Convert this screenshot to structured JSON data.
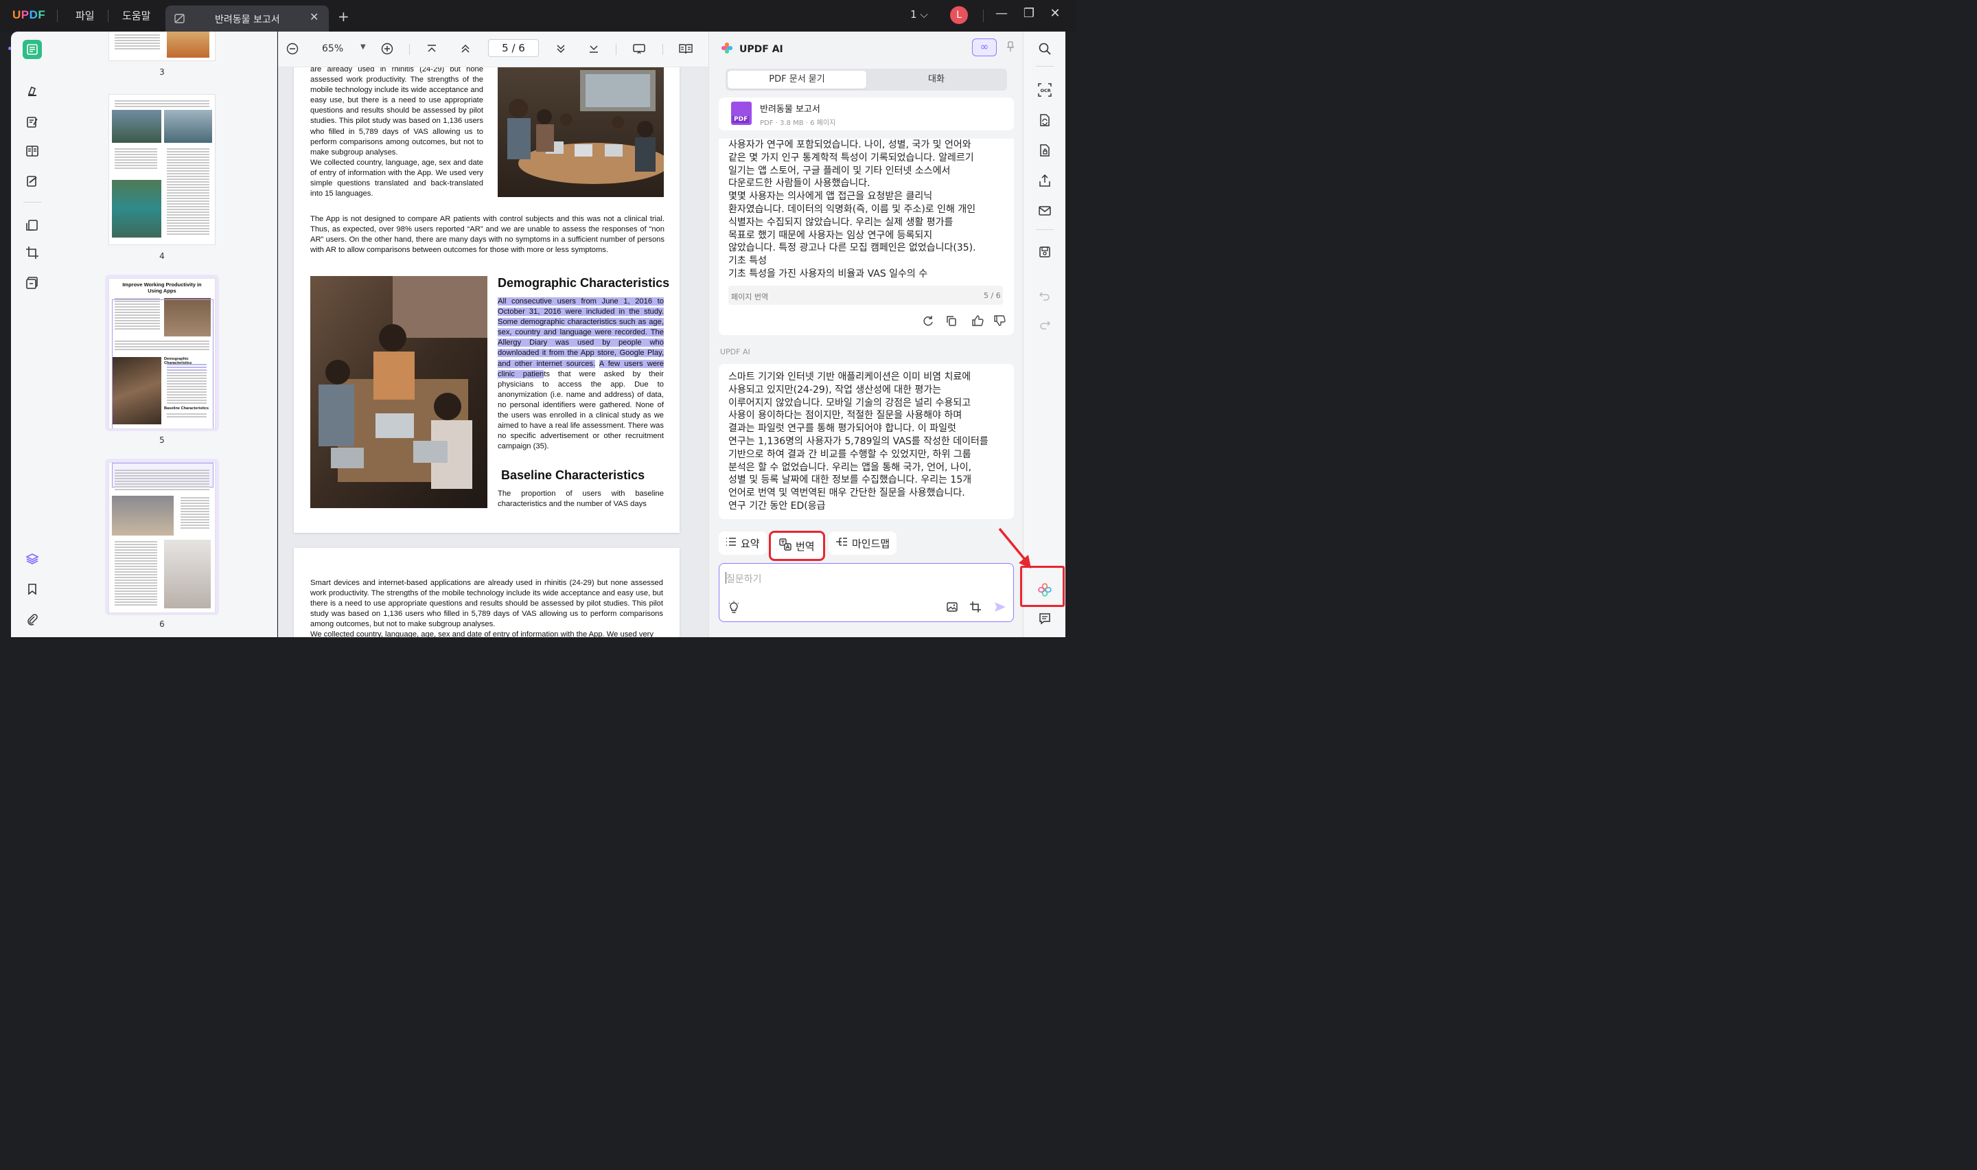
{
  "app": {
    "logo": "UPDF",
    "menus": [
      "파일",
      "도움말"
    ],
    "tab_title": "반려동물 보고서",
    "page_indicator": "1",
    "avatar_letter": "L"
  },
  "thumbnails": {
    "pages": [
      {
        "num": "3"
      },
      {
        "num": "4"
      },
      {
        "num": "5",
        "title": "Improve Working Productivity in Using Apps",
        "heading1": "Demographic Characteristics",
        "heading2": "Baseline Characteristics"
      },
      {
        "num": "6"
      }
    ]
  },
  "toolbar": {
    "zoom": "65%",
    "page_current": "5",
    "page_total": "6"
  },
  "document": {
    "col_top": "are already used in rhinitis (24-29) but none assessed work productivity. The strengths of the mobile technology include its wide acceptance and easy use, but there is a need to use appropriate questions and results should be assessed by pilot studies. This pilot study was based on 1,136 users who filled in 5,789 days of VAS allowing us to perform comparisons among outcomes, but not to make subgroup analyses.",
    "col_top2": "We collected country, language, age, sex and date of entry of information with the App. We used very simple questions translated and back-translated into 15 languages.",
    "para_full": "The App is not designed to compare AR patients with control subjects and this was not a clinical trial. Thus, as expected, over 98% users reported “AR” and we are unable to assess the responses of “non AR” users. On the other hand, there are many days with no symptoms in a sufficient number of persons with AR to allow comparisons between outcomes for those with more or less symptoms.",
    "heading_demo": "Demographic Characteristics",
    "demo_highlight": "All consecutive users from June 1, 2016 to October 31, 2016 were included in the study. Some demographic characteristics such as age, sex, country and language were recorded. The Allergy Diary was used by people who downloaded it from the App store, Google Play, and other internet sources.",
    "demo_highlight2": "A few users were clinic patien",
    "demo_rest": "ts that were asked by their physicians to access the app. Due to anonymization (i.e. name and address) of data, no personal identifiers were gathered. None of the users was enrolled in a clinical study as we aimed to have a real life assessment. There was no specific advertisement or other recruitment campaign (35).",
    "heading_base": "Baseline Characteristics",
    "base_text": "The proportion of users with baseline characteristics and the number of VAS days",
    "page6_p1": "Smart devices and internet-based applications are already used in rhinitis (24-29) but none assessed work productivity. The strengths of the mobile technology include its wide acceptance and easy use, but there is a need to use appropriate questions and results should be assessed by pilot studies. This pilot study was based on 1,136 users who filled in 5,789 days of VAS allowing us to perform comparisons among outcomes, but not to make subgroup analyses.",
    "page6_p2": "We collected country, language, age, sex and date of entry of information with the App. We used very"
  },
  "ai": {
    "title": "UPDF AI",
    "infinity": "∞",
    "tabs": [
      "PDF 문서 묻기",
      "대화"
    ],
    "file_name": "반려동물 보고서",
    "file_meta": "PDF · 3.8 MB · 6 페이지",
    "pdf_badge": "PDF",
    "answer1_lines": [
      "사용자가 연구에 포함되었습니다. 나이, 성별, 국가 및 언어와",
      "같은 몇 가지 인구 통계학적 특성이 기록되었습니다. 알레르기",
      "일기는 앱 스토어, 구글 플레이 및 기타 인터넷 소스에서",
      "다운로드한 사람들이 사용했습니다.",
      "몇몇 사용자는 의사에게 앱 접근을 요청받은 클리닉",
      "환자였습니다. 데이터의 익명화(즉, 이름 및 주소)로 인해 개인",
      "식별자는 수집되지 않았습니다. 우리는 실제 생활 평가를",
      "목표로 했기 때문에 사용자는 임상 연구에 등록되지",
      "않았습니다. 특정 광고나 다른 모집 캠페인은 없었습니다(35).",
      "기초 특성",
      "기초 특성을 가진 사용자의 비율과 VAS 일수의 수"
    ],
    "translate_tag": "페이지 번역",
    "translate_page": "5 / 6",
    "ai_label": "UPDF AI",
    "answer2_lines": [
      "스마트 기기와 인터넷 기반 애플리케이션은 이미 비염 치료에",
      "사용되고 있지만(24-29), 작업 생산성에 대한 평가는",
      "이루어지지 않았습니다. 모바일 기술의 강점은 널리 수용되고",
      "사용이 용이하다는 점이지만, 적절한 질문을 사용해야 하며",
      "결과는 파일럿 연구를 통해 평가되어야 합니다. 이 파일럿",
      "연구는 1,136명의 사용자가 5,789일의 VAS를 작성한 데이터를",
      "기반으로 하여 결과 간 비교를 수행할 수 있었지만, 하위 그룹",
      "분석은 할 수 없었습니다. 우리는 앱을 통해 국가, 언어, 나이,",
      "성별 및 등록 날짜에 대한 정보를 수집했습니다. 우리는 15개",
      "언어로 번역 및 역번역된 매우 간단한 질문을 사용했습니다.",
      "연구 기간 동안 ED(응급"
    ],
    "chips": [
      "요약",
      "번역",
      "마인드맵"
    ],
    "input_placeholder": "질문하기"
  },
  "colors": {
    "accent_green": "#2ebd85",
    "accent_purple": "#8a7cff",
    "highlight": "#b7b4f2",
    "annotation_red": "#e8262f"
  }
}
